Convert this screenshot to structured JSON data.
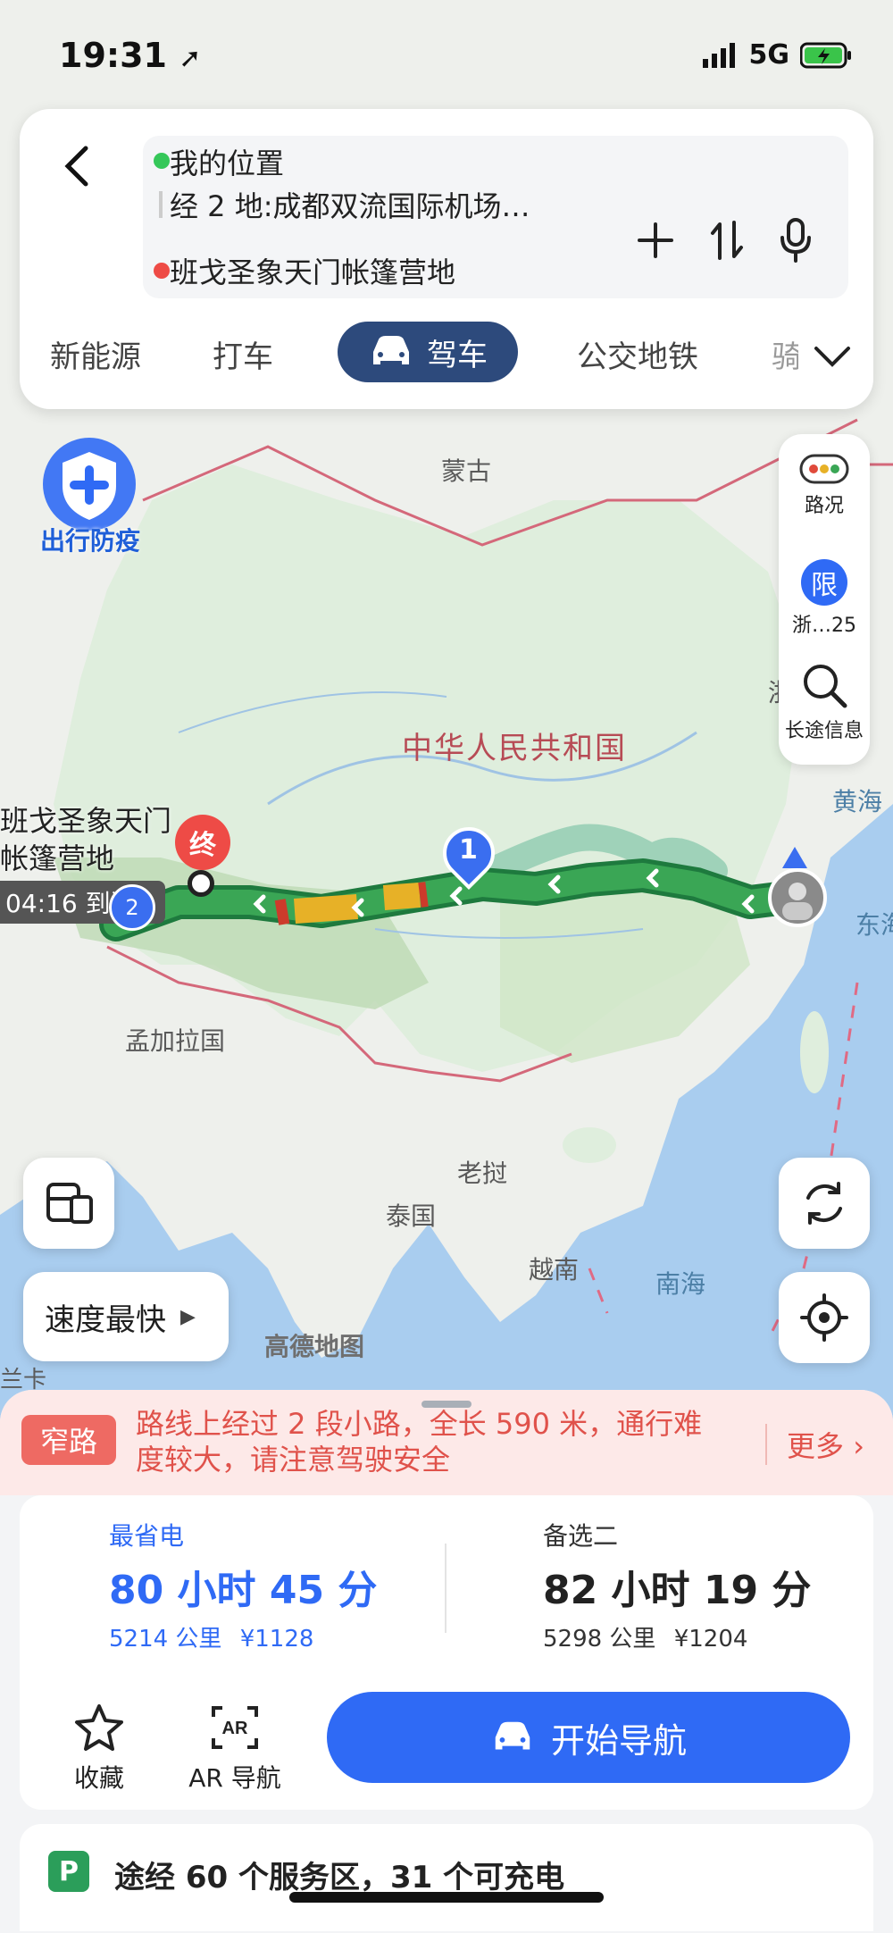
{
  "status_bar": {
    "time": "19:31",
    "network": "5G"
  },
  "route": {
    "origin": "我的位置",
    "waypoint": "经 2 地:成都双流国际机场…",
    "destination": "班戈圣象天门帐篷营地"
  },
  "modes": {
    "new_energy": "新能源",
    "taxi": "打车",
    "drive": "驾车",
    "transit": "公交地铁",
    "more": "骑"
  },
  "badge": {
    "label": "出行防疫"
  },
  "tools": {
    "traffic": "路况",
    "restrict_icon": "限",
    "restrict": "浙…25",
    "long_trip": "长途信息"
  },
  "map": {
    "labels": {
      "mongolia": "蒙古",
      "china": "中华人民共和国",
      "bangladesh": "孟加拉国",
      "laos": "老挝",
      "thailand": "泰国",
      "vietnam": "越南",
      "south_sea": "南海",
      "yellow_sea": "黄海",
      "east_sea": "东海",
      "coast_partial": "浙",
      "lanka_partial": "兰卡",
      "watermark": "高德地图"
    },
    "dest_name_line1": "班戈圣象天门",
    "dest_name_line2": "帐篷营地",
    "arrival": "04:16 到达",
    "end_marker": "终",
    "waypoint_1": "1",
    "waypoint_2": "2"
  },
  "speed_mode": "速度最快",
  "warning": {
    "badge": "窄路",
    "text": "路线上经过 2 段小路，全长 590 米，通行难度较大，请注意驾驶安全",
    "more": "更多"
  },
  "options": [
    {
      "label": "最省电",
      "time": "80 小时 45 分",
      "distance": "5214 公里",
      "cost": "¥1128"
    },
    {
      "label": "备选二",
      "time": "82 小时 19 分",
      "distance": "5298 公里",
      "cost": "¥1204"
    }
  ],
  "actions": {
    "favorite": "收藏",
    "ar_nav": "AR 导航",
    "start_nav": "开始导航"
  },
  "service": "途经 60 个服务区，31 个可充电",
  "colors": {
    "accent": "#2f6af5",
    "route_green": "#2f9e44",
    "warn": "#e0524b",
    "drive_tab": "#2d4a7c"
  }
}
